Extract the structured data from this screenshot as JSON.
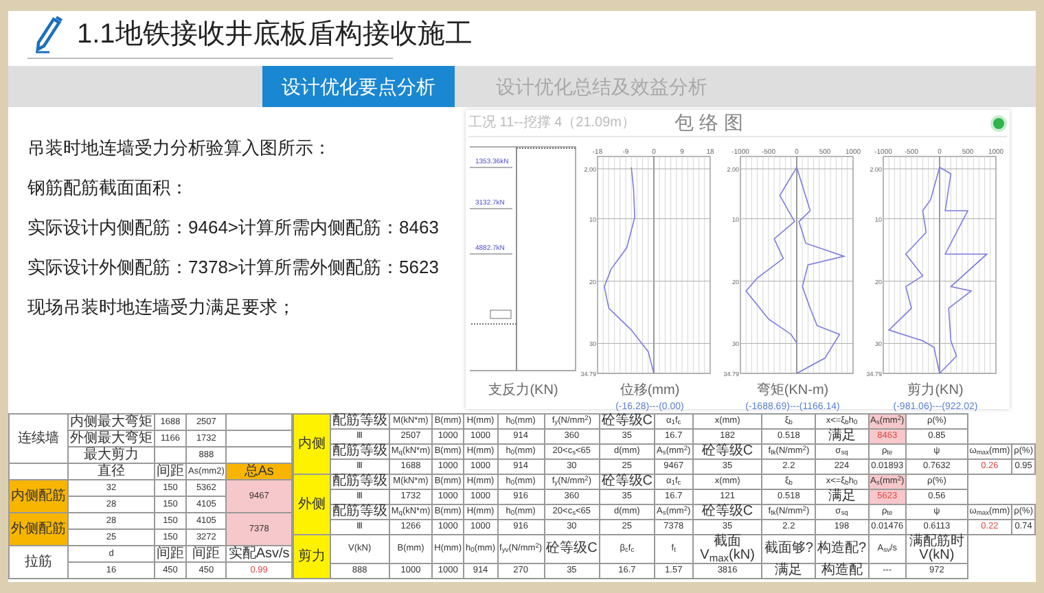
{
  "header": {
    "title": "1.1地铁接收井底板盾构接收施工"
  },
  "tabs": [
    {
      "label": "设计优化要点分析",
      "selected": true
    },
    {
      "label": "设计优化总结及效益分析",
      "selected": false
    }
  ],
  "paragraphs": [
    "吊装时地连墙受力分析验算入图所示：",
    "钢筋配筋截面面积：",
    "实际设计内侧配筋：9464>计算所需内侧配筋：8463",
    "实际设计外侧配筋：7378>计算所需外侧配筋：5623",
    "现场吊装时地连墙受力满足要求；"
  ],
  "envelope_figure": {
    "caption": "工况 11--挖撑 4（21.09m）",
    "title": "包 络 图",
    "support_panel": {
      "label": "支反力(KN)",
      "forces": [
        "1353.36kN",
        "3132.7kN",
        "4882.7kN"
      ]
    },
    "plots": [
      {
        "label": "位移(mm)",
        "range": "(-16.28)---(0.00)",
        "x_ticks": [
          "-18",
          "-9",
          "0",
          "9",
          "18"
        ],
        "y_ticks": [
          "2.00",
          "10",
          "20",
          "30",
          "34.79"
        ]
      },
      {
        "label": "弯矩(KN-m)",
        "range": "(-1688.69)---(1166.14)",
        "x_ticks": [
          "-1000",
          "-500",
          "0",
          "500",
          "1000"
        ],
        "y_ticks": [
          "2.00",
          "10",
          "20",
          "30",
          "34.79"
        ]
      },
      {
        "label": "剪力(KN)",
        "range": "(-981.06)---(922.02)",
        "x_ticks": [
          "-1000",
          "-500",
          "0",
          "500",
          "1000"
        ],
        "y_ticks": [
          "2.00",
          "10",
          "20",
          "30",
          "34.79"
        ]
      }
    ]
  },
  "load_table": {
    "groups": [
      {
        "label": "连续墙",
        "rows": [
          [
            "内侧最大弯矩",
            "1688",
            "2507",
            null
          ],
          [
            "外侧最大弯矩",
            "1166",
            "1732",
            null
          ],
          [
            "最大剪力",
            null,
            "888",
            null
          ]
        ]
      },
      {
        "rows": [
          [
            "直径",
            "间距",
            "As(mm2)",
            {
              "text": "总As",
              "kind": "orange"
            }
          ]
        ]
      },
      {
        "label": "内侧配筋",
        "kind": "orange",
        "total": "9467",
        "rows": [
          [
            "32",
            "150",
            "5362"
          ],
          [
            "28",
            "150",
            "4105"
          ]
        ]
      },
      {
        "label": "外侧配筋",
        "kind": "orange",
        "total": "7378",
        "rows": [
          [
            "28",
            "150",
            "4105"
          ],
          [
            "25",
            "150",
            "3272"
          ]
        ]
      },
      {
        "label": "拉筋",
        "rows": [
          [
            "d",
            "间距",
            "间距",
            "实配Asv/s"
          ],
          [
            "16",
            "450",
            "450",
            {
              "text": "0.99",
              "kind": "red"
            }
          ]
        ]
      }
    ]
  },
  "design_table": {
    "sections": [
      {
        "label": "内侧",
        "rows": [
          [
            "配筋等级",
            "M(kN*m)",
            "B(mm)",
            "H(mm)",
            "h$_{0}$(mm)",
            "f$_{y}$(N/mm$^{2}$)",
            "砼等级C",
            "α$_{1}$f$_{c}$",
            "x(mm)",
            "ξ$_{b}$",
            "x<=ξ$_{b}$h$_{0}$",
            {
              "text": "A$_{s}$(mm$^{2}$)",
              "kind": "pink"
            },
            "ρ(%)"
          ],
          [
            "Ⅲ",
            "2507",
            "1000",
            "1000",
            "914",
            "360",
            "35",
            "16.7",
            "182",
            "0.518",
            "满足",
            {
              "text": "8463",
              "kind": "pink-red"
            },
            "0.85"
          ],
          [
            "配筋等级",
            "M$_{q}$(kN*m)",
            "B(mm)",
            "H(mm)",
            "h$_{0}$(mm)",
            "20<c$_{s}$<65",
            "d(mm)",
            "A$_{s}$(mm$^{2}$)",
            "砼等级C",
            "f$_{tk}$(N/mm$^{2}$)",
            "σ$_{sq}$",
            "ρ$_{te}$",
            "ψ",
            "ω$_{max}$(mm)",
            "ρ(%)"
          ],
          [
            "Ⅲ",
            "1688",
            "1000",
            "1000",
            "914",
            "30",
            "25",
            "9467",
            "35",
            "2.2",
            "224",
            "0.01893",
            "0.7632",
            {
              "text": "0.26",
              "kind": "red"
            },
            "0.95"
          ]
        ]
      },
      {
        "label": "外侧",
        "rows": [
          [
            "配筋等级",
            "M(kN*m)",
            "B(mm)",
            "H(mm)",
            "h$_{0}$(mm)",
            "f$_{y}$(N/mm$^{2}$)",
            "砼等级C",
            "α$_{1}$f$_{c}$",
            "x(mm)",
            "ξ$_{b}$",
            "x<=ξ$_{b}$h$_{0}$",
            {
              "text": "A$_{s}$(mm$^{2}$)",
              "kind": "pink"
            },
            "ρ(%)"
          ],
          [
            "Ⅲ",
            "1732",
            "1000",
            "1000",
            "916",
            "360",
            "35",
            "16.7",
            "121",
            "0.518",
            "满足",
            {
              "text": "5623",
              "kind": "pink-red"
            },
            "0.56"
          ],
          [
            "配筋等级",
            "M$_{q}$(kN*m)",
            "B(mm)",
            "H(mm)",
            "h$_{0}$(mm)",
            "20<c$_{s}$<65",
            "d(mm)",
            "A$_{s}$(mm$^{2}$)",
            "砼等级C",
            "f$_{tk}$(N/mm$^{2}$)",
            "σ$_{sq}$",
            "ρ$_{te}$",
            "ψ",
            "ω$_{max}$(mm)",
            "ρ(%)"
          ],
          [
            "Ⅲ",
            "1266",
            "1000",
            "1000",
            "916",
            "30",
            "25",
            "7378",
            "35",
            "2.2",
            "198",
            "0.01476",
            "0.6113",
            {
              "text": "0.22",
              "kind": "red"
            },
            "0.74"
          ]
        ]
      },
      {
        "label": "剪力",
        "rows": [
          [
            "V(kN)",
            "B(mm)",
            "H(mm)",
            "h$_{0}$(mm)",
            "f$_{yv}$(N/mm$^{2}$)",
            "砼等级C",
            "β$_{c}$f$_{c}$",
            "f$_{t}$",
            "截面V$_{max}$(kN)",
            "截面够?",
            "构造配?",
            "A$_{sv}$/s",
            "满配筋时V(kN)"
          ],
          [
            "888",
            "1000",
            "1000",
            "914",
            "270",
            "35",
            "16.7",
            "1.57",
            "3816",
            "满足",
            "构造配",
            "---",
            "972"
          ]
        ]
      }
    ]
  }
}
